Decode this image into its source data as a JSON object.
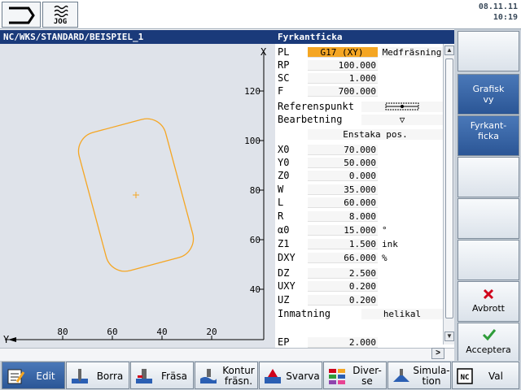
{
  "header": {
    "mode_icon": "machine-mode-icon",
    "jog_label": "JOG",
    "date": "08.11.11",
    "time": "10:19"
  },
  "program_path": "NC/WKS/STANDARD/BEISPIEL_1",
  "form": {
    "title": "Fyrkantficka",
    "rows": [
      {
        "label": "PL",
        "value": "G17 (XY)",
        "extra": "Medfräsning"
      },
      {
        "label": "RP",
        "value": "100.000"
      },
      {
        "label": "SC",
        "value": "1.000"
      },
      {
        "label": "F",
        "value": "700.000"
      },
      {
        "label": "Referenspunkt",
        "icon": "reference-point-icon"
      },
      {
        "label": "Bearbetning",
        "icon": "machining-symbol-icon",
        "symbol": "▽"
      },
      {
        "label": "",
        "value": "Enstaka pos."
      },
      {
        "label": "X0",
        "value": "70.000"
      },
      {
        "label": "Y0",
        "value": "50.000"
      },
      {
        "label": "Z0",
        "value": "0.000"
      },
      {
        "label": "W",
        "value": "35.000"
      },
      {
        "label": "L",
        "value": "60.000"
      },
      {
        "label": "R",
        "value": "8.000"
      },
      {
        "label": "α0",
        "value": "15.000",
        "unit": "°"
      },
      {
        "label": "Z1",
        "value": "1.500",
        "unit": "ink"
      },
      {
        "label": "DXY",
        "value": "66.000",
        "unit": "%"
      },
      {
        "label": "DZ",
        "value": "2.500"
      },
      {
        "label": "UXY",
        "value": "0.200"
      },
      {
        "label": "UZ",
        "value": "0.200"
      },
      {
        "label": "Inmatning",
        "value": "helikal"
      },
      {
        "label": "EP",
        "value": "2.000"
      }
    ]
  },
  "graphic": {
    "x_axis_label": "X",
    "y_axis_label": "Y",
    "x_ticks": [
      "120",
      "100",
      "80",
      "60",
      "40"
    ],
    "y_ticks": [
      "80",
      "60",
      "40",
      "20"
    ],
    "pocket_color": "#f5a623"
  },
  "softkeys_right": [
    {
      "label": ""
    },
    {
      "label": "Grafisk\nvy",
      "active": true
    },
    {
      "label": "Fyrkant-\nficka",
      "active": true
    },
    {
      "label": ""
    },
    {
      "label": ""
    },
    {
      "label": ""
    },
    {
      "label": "Avbrott",
      "icon": "cancel-icon"
    },
    {
      "label": "Acceptera",
      "icon": "accept-icon"
    }
  ],
  "softkeys_bottom": [
    {
      "label": "Edit",
      "icon": "edit-icon",
      "active": true
    },
    {
      "label": "Borra",
      "icon": "drill-icon"
    },
    {
      "label": "Fräsa",
      "icon": "mill-icon"
    },
    {
      "label": "Kontur\nfräsn.",
      "icon": "contour-mill-icon"
    },
    {
      "label": "Svarva",
      "icon": "turn-icon"
    },
    {
      "label": "Diver-\nse",
      "icon": "misc-icon"
    },
    {
      "label": "Simula-\ntion",
      "icon": "simulation-icon"
    },
    {
      "label": "Val",
      "icon": "nc-select-icon"
    }
  ]
}
